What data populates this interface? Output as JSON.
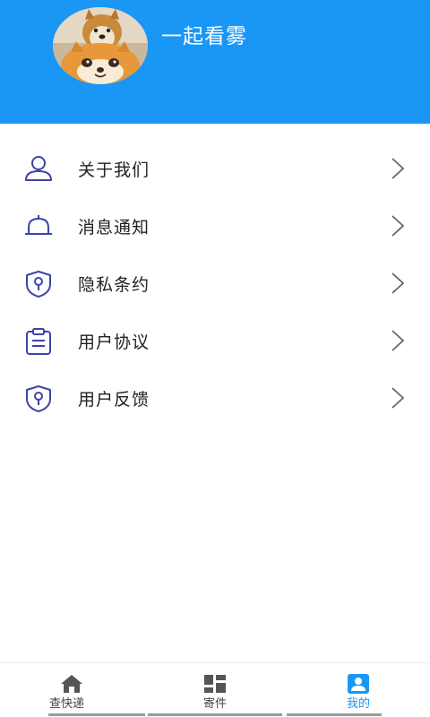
{
  "header": {
    "username": "一起看雾",
    "background_color": "#1a97f5",
    "avatar": "shiba-dog-avatar"
  },
  "menu": {
    "items": [
      {
        "label": "关于我们",
        "icon": "user-icon"
      },
      {
        "label": "消息通知",
        "icon": "bell-icon"
      },
      {
        "label": "隐私条约",
        "icon": "shield-key-icon"
      },
      {
        "label": "用户协议",
        "icon": "clipboard-icon"
      },
      {
        "label": "用户反馈",
        "icon": "shield-key-icon"
      }
    ],
    "icon_color": "#3d44a8"
  },
  "tabbar": {
    "tabs": [
      {
        "label": "查快递",
        "icon": "home-icon",
        "active": false
      },
      {
        "label": "寄件",
        "icon": "grid-icon",
        "active": false
      },
      {
        "label": "我的",
        "icon": "profile-icon",
        "active": true
      }
    ],
    "active_color": "#1a97f5"
  }
}
